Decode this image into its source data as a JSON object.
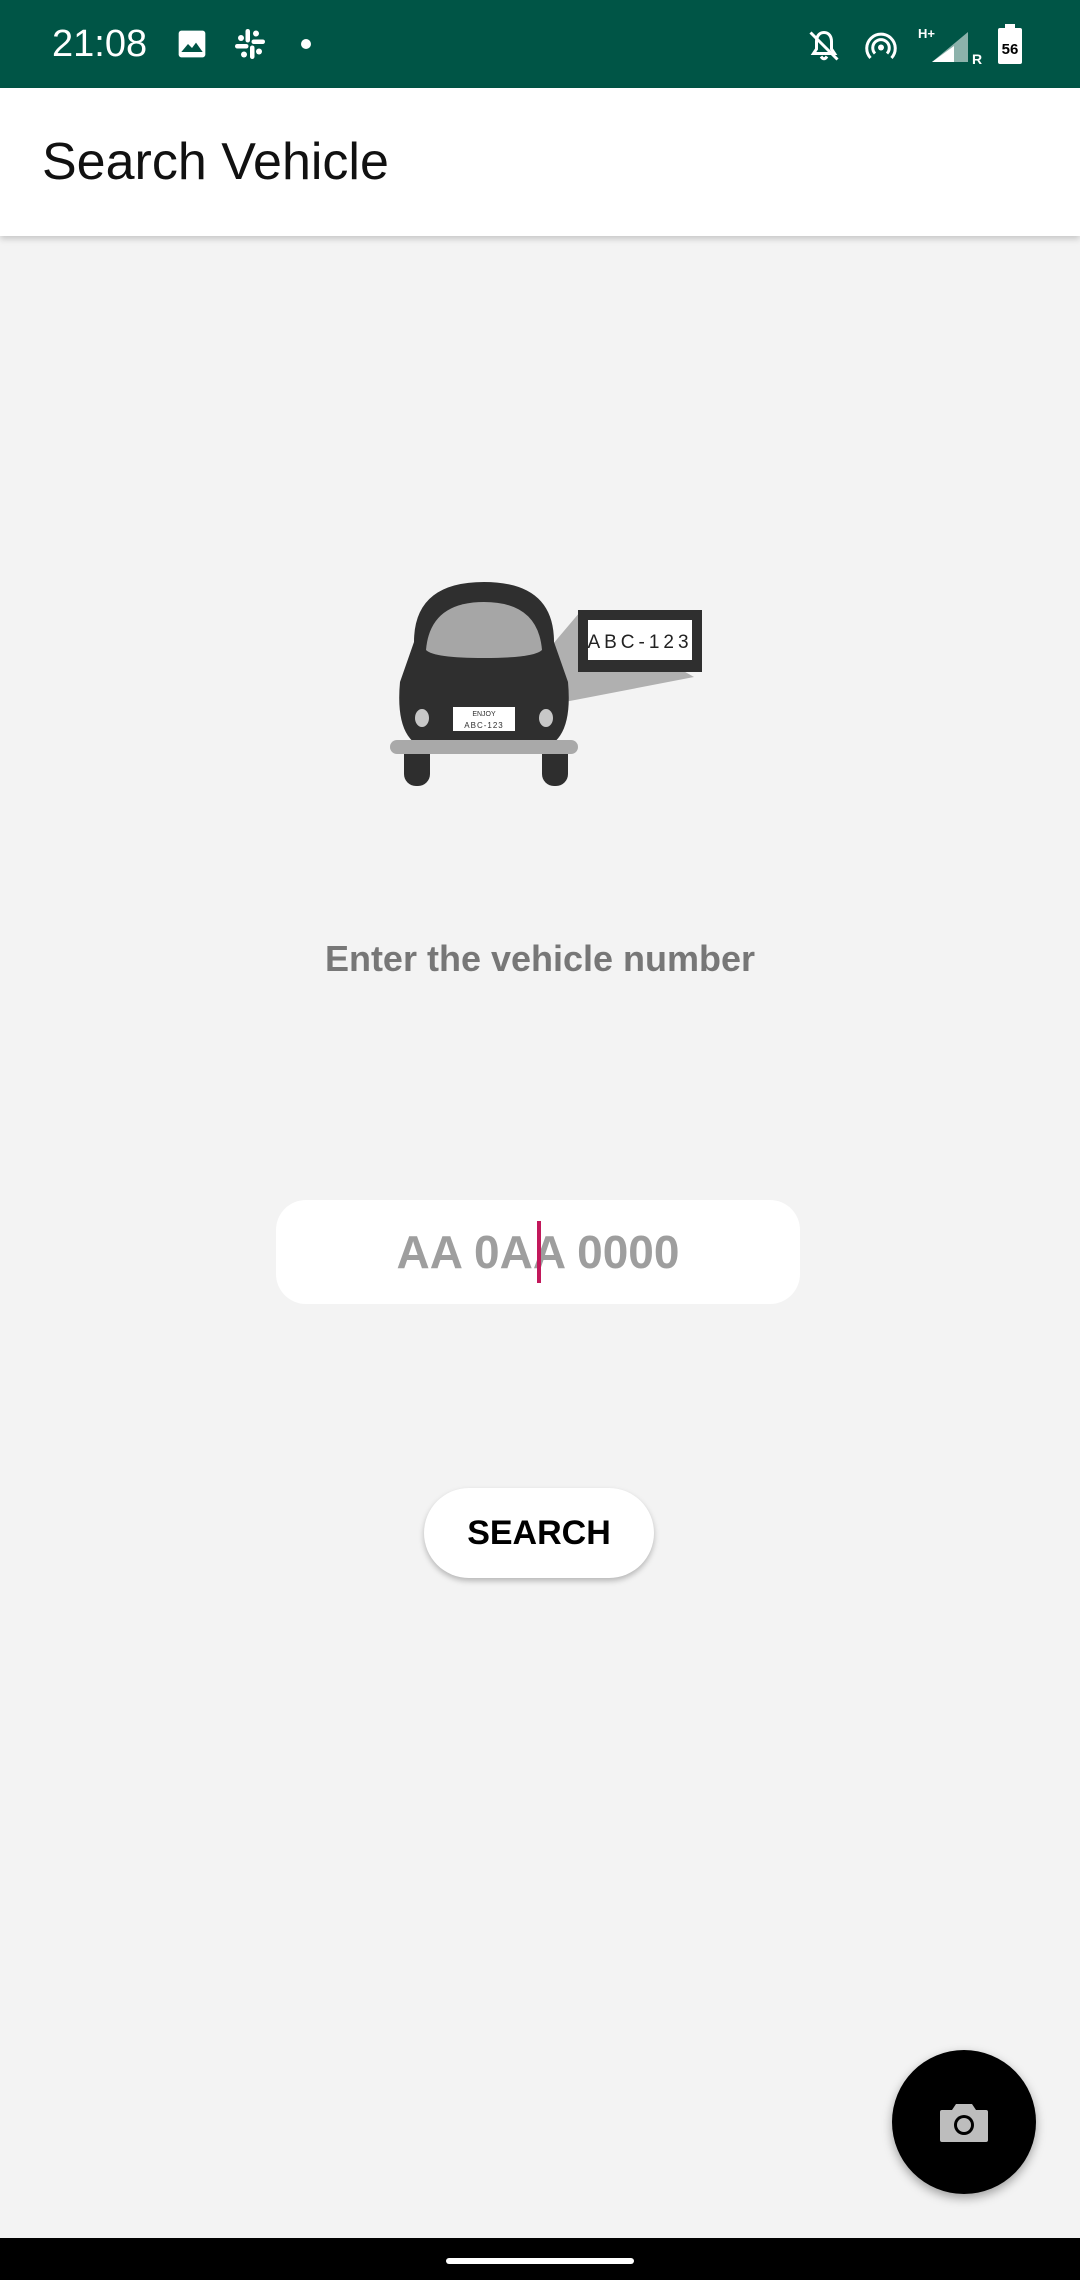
{
  "status_bar": {
    "time": "21:08",
    "network_type": "H+",
    "roaming": "R",
    "battery": "56",
    "icons_left": [
      "image-icon",
      "slack-icon",
      "dot-icon"
    ],
    "icons_right": [
      "bell-off-icon",
      "hotspot-icon",
      "signal-icon",
      "battery-icon"
    ],
    "color": "#005546"
  },
  "app_bar": {
    "title": "Search Vehicle"
  },
  "illustration": {
    "plate_text": "ABC-123",
    "small_plate_top": "ENJOY",
    "small_plate_bottom": "ABC-123"
  },
  "main": {
    "instruction": "Enter the vehicle number",
    "input": {
      "value": "",
      "placeholder": "AA 0AA 0000"
    },
    "search_button_label": "SEARCH"
  },
  "fab": {
    "icon": "camera-icon"
  },
  "colors": {
    "accent_caret": "#c2185b",
    "background": "#f3f3f3"
  }
}
